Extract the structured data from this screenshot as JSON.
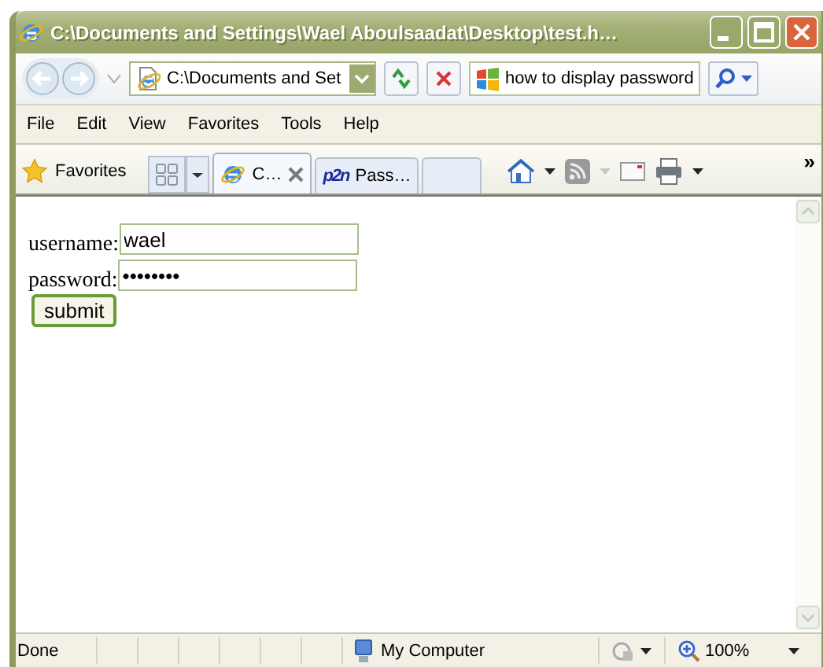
{
  "window": {
    "title": "C:\\Documents and Settings\\Wael Aboulsaadat\\Desktop\\test.h…"
  },
  "address_bar": {
    "value": "C:\\Documents and Set"
  },
  "search": {
    "value": "how to display password"
  },
  "menu": [
    "File",
    "Edit",
    "View",
    "Favorites",
    "Tools",
    "Help"
  ],
  "favorites": {
    "label": "Favorites"
  },
  "tabs": [
    {
      "label": "C…",
      "selected": true,
      "kind": "browser"
    },
    {
      "label": "Pass…",
      "selected": false,
      "kind": "logo",
      "logo_text": "p2n"
    }
  ],
  "chevron": "»",
  "form": {
    "fields": [
      {
        "label": "username:",
        "value": "wael"
      },
      {
        "label": "password:",
        "value": "••••••••"
      }
    ],
    "submit": "submit"
  },
  "status_bar": {
    "text": "Done",
    "zone": "My Computer",
    "zoom": "100%"
  }
}
